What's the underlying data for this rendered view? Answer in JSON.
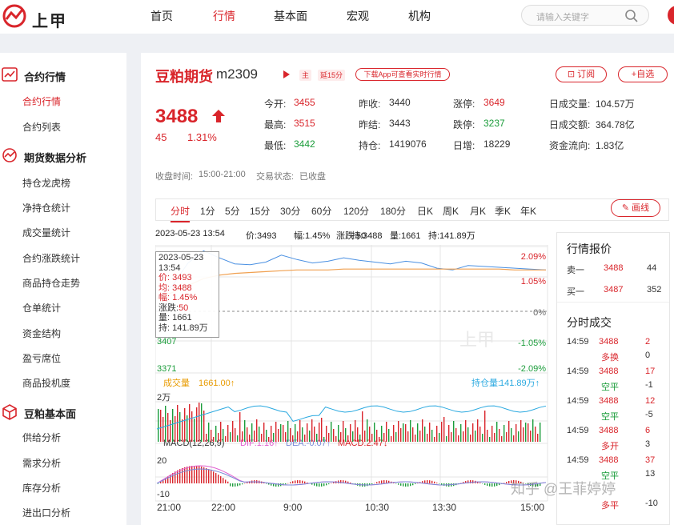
{
  "header": {
    "logo_text": "上甲",
    "nav": [
      "首页",
      "行情",
      "基本面",
      "宏观",
      "机构"
    ],
    "active_nav": 1,
    "search_placeholder": "请输入关键字"
  },
  "sidebar": {
    "groups": [
      {
        "title": "合约行情",
        "icon": "line-chart-icon",
        "items": [
          "合约行情",
          "合约列表"
        ]
      },
      {
        "title": "期货数据分析",
        "icon": "analysis-chart-icon",
        "items": [
          "持仓龙虎榜",
          "净持仓统计",
          "成交量统计",
          "合约涨跌统计",
          "商品持仓走势",
          "仓单统计",
          "资金结构",
          "盈亏席位",
          "商品投机度"
        ]
      },
      {
        "title": "豆粕基本面",
        "icon": "cube-icon",
        "items": [
          "供给分析",
          "需求分析",
          "库存分析",
          "进出口分析"
        ]
      }
    ],
    "active_item": "合约行情"
  },
  "quote": {
    "name": "豆粕期货",
    "code": "m2309",
    "tag_main": "主",
    "tag_delay": "延15分",
    "download_label": "下载App可查看实时行情",
    "subscribe_label": "订阅",
    "watch_label": "+自选",
    "price": "3488",
    "change": "45",
    "change_pct": "1.31%",
    "stats": [
      {
        "label": "今开:",
        "value": "3455",
        "color": "red"
      },
      {
        "label": "昨收:",
        "value": "3440",
        "color": "black"
      },
      {
        "label": "涨停:",
        "value": "3649",
        "color": "red"
      },
      {
        "label": "日成交量:",
        "value": "104.57万",
        "color": "black"
      },
      {
        "label": "最高:",
        "value": "3515",
        "color": "red"
      },
      {
        "label": "昨结:",
        "value": "3443",
        "color": "black"
      },
      {
        "label": "跌停:",
        "value": "3237",
        "color": "green"
      },
      {
        "label": "日成交额:",
        "value": "364.78亿",
        "color": "black"
      },
      {
        "label": "最低:",
        "value": "3442",
        "color": "green"
      },
      {
        "label": "持仓:",
        "value": "1419076",
        "color": "black"
      },
      {
        "label": "日增:",
        "value": "18229",
        "color": "black"
      },
      {
        "label": "资金流向:",
        "value": "1.83亿",
        "color": "black"
      }
    ],
    "close_time_label": "收盘时间:",
    "close_time": "15:00-21:00",
    "trade_status_label": "交易状态:",
    "trade_status": "已收盘"
  },
  "chart_tabs": [
    "分时",
    "1分",
    "5分",
    "15分",
    "30分",
    "60分",
    "120分",
    "180分",
    "日K",
    "周K",
    "月K",
    "季K",
    "年K"
  ],
  "active_tab": "分时",
  "draw_label": "画线",
  "info_bar": {
    "datetime": "2023-05-23 13:54",
    "price": "价:3493",
    "amplitude": "幅:1.45%",
    "change": "涨跌:50",
    "position": "持:3488",
    "volume": "量:1661",
    "hold": "持:141.89万"
  },
  "tooltip": {
    "date": "2023-05-23",
    "time": "13:54",
    "price": "价: 3493",
    "avg": "均: 3488",
    "amp": "幅: 1.45%",
    "change_label": "涨跌:",
    "change": "50",
    "vol": "量: 1661",
    "hold": "持: 141.89万"
  },
  "colors": {
    "accent": "#d9252b",
    "up": "#d9252b",
    "down": "#1a9c3a",
    "price_line": "#4a90e2",
    "avg_line": "#f0a050",
    "oi_line": "#2aa9e0",
    "dif": "#e060d0",
    "dea": "#7a8ad8",
    "macd": "#d9252b"
  },
  "chart_data": [
    {
      "type": "line",
      "name": "intraday",
      "x": [
        "21:00",
        "22:00",
        "9:00",
        "10:30",
        "13:30",
        "15:00"
      ],
      "y_ticks_left": [
        "3407",
        "3371"
      ],
      "y_ticks_right": [
        "2.09%",
        "1.05%",
        "0%",
        "-1.05%",
        "-2.09%"
      ],
      "ylim": [
        3371,
        3515
      ],
      "series": [
        {
          "name": "价",
          "values": [
            3455,
            3470,
            3496,
            3510,
            3502,
            3495,
            3494,
            3497,
            3505,
            3500,
            3496,
            3498,
            3502,
            3499,
            3497,
            3495,
            3498,
            3496,
            3490,
            3488,
            3493,
            3492,
            3491,
            3490,
            3489,
            3488
          ]
        },
        {
          "name": "均",
          "values": [
            3455,
            3462,
            3470,
            3478,
            3482,
            3484,
            3485,
            3486,
            3487,
            3488,
            3488,
            3488,
            3489,
            3489,
            3489,
            3489,
            3489,
            3489,
            3489,
            3489,
            3489,
            3489,
            3489,
            3488,
            3488,
            3488
          ]
        }
      ]
    },
    {
      "type": "bar",
      "name": "volume",
      "title": "成交量",
      "current_volume": "1661.00↑",
      "hold_label": "持仓量:",
      "hold_value": "141.89万↑",
      "y_tick": "2万"
    },
    {
      "type": "bar",
      "name": "macd",
      "params": "MACD(12,26,9)",
      "dif": "DIF:1.16↑",
      "dea": "DEA:-0.07↑",
      "macd": "MACD:2.47↓",
      "y_ticks": [
        "20",
        "-10"
      ]
    }
  ],
  "panel": {
    "quote_title": "行情报价",
    "ask_label": "卖一",
    "ask_price": "3488",
    "ask_vol": "44",
    "bid_label": "买一",
    "bid_price": "3487",
    "bid_vol": "352",
    "trades_title": "分时成交",
    "trades": [
      {
        "time": "14:59",
        "price": "3488",
        "vol": "2",
        "type": "多换",
        "oi": "0"
      },
      {
        "time": "14:59",
        "price": "3488",
        "vol": "17",
        "type": "空平",
        "oi": "-1"
      },
      {
        "time": "14:59",
        "price": "3488",
        "vol": "12",
        "type": "空平",
        "oi": "-5"
      },
      {
        "time": "14:59",
        "price": "3488",
        "vol": "6",
        "type": "多开",
        "oi": "3"
      },
      {
        "time": "14:59",
        "price": "3488",
        "vol": "37",
        "type": "空平",
        "oi": "13"
      },
      {
        "time": "",
        "price": "",
        "vol": "",
        "type": "多平",
        "oi": "-10"
      }
    ]
  },
  "watermark": {
    "right": "知乎 @王菲婷婷",
    "center": "上甲"
  }
}
